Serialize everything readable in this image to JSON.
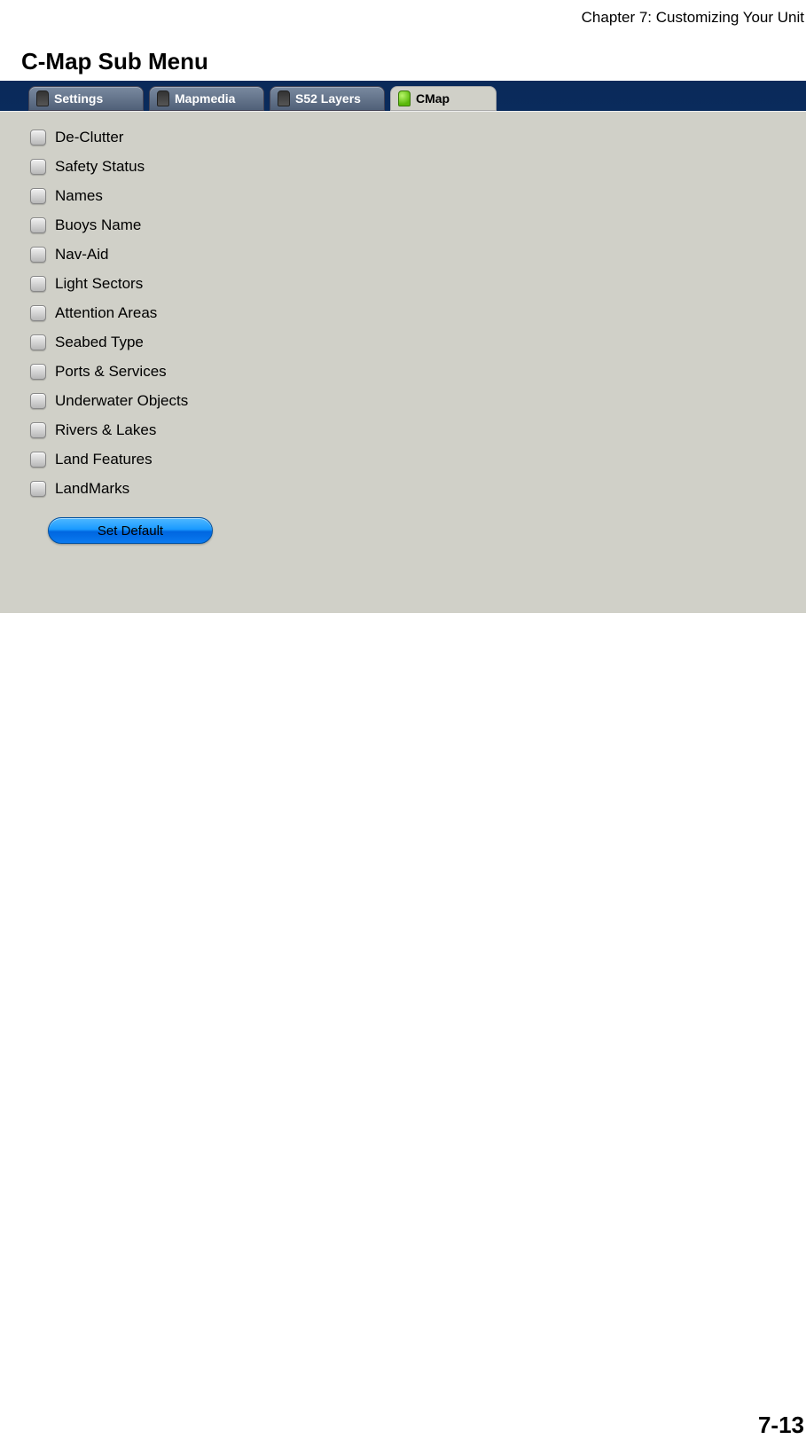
{
  "chapter_header": "Chapter 7: Customizing Your Unit",
  "section_title": "C-Map Sub Menu",
  "tabs": [
    {
      "label": "Settings",
      "active": false,
      "iconClass": "dark"
    },
    {
      "label": "Mapmedia",
      "active": false,
      "iconClass": "dark"
    },
    {
      "label": "S52 Layers",
      "active": false,
      "iconClass": "dark"
    },
    {
      "label": "CMap",
      "active": true,
      "iconClass": "green"
    }
  ],
  "options": [
    "De-Clutter",
    "Safety Status",
    "Names",
    "Buoys Name",
    "Nav-Aid",
    "Light Sectors",
    "Attention Areas",
    "Seabed Type",
    "Ports & Services",
    "Underwater Objects",
    "Rivers & Lakes",
    "Land Features",
    "LandMarks"
  ],
  "set_default_label": "Set Default",
  "page_number": "7-13"
}
